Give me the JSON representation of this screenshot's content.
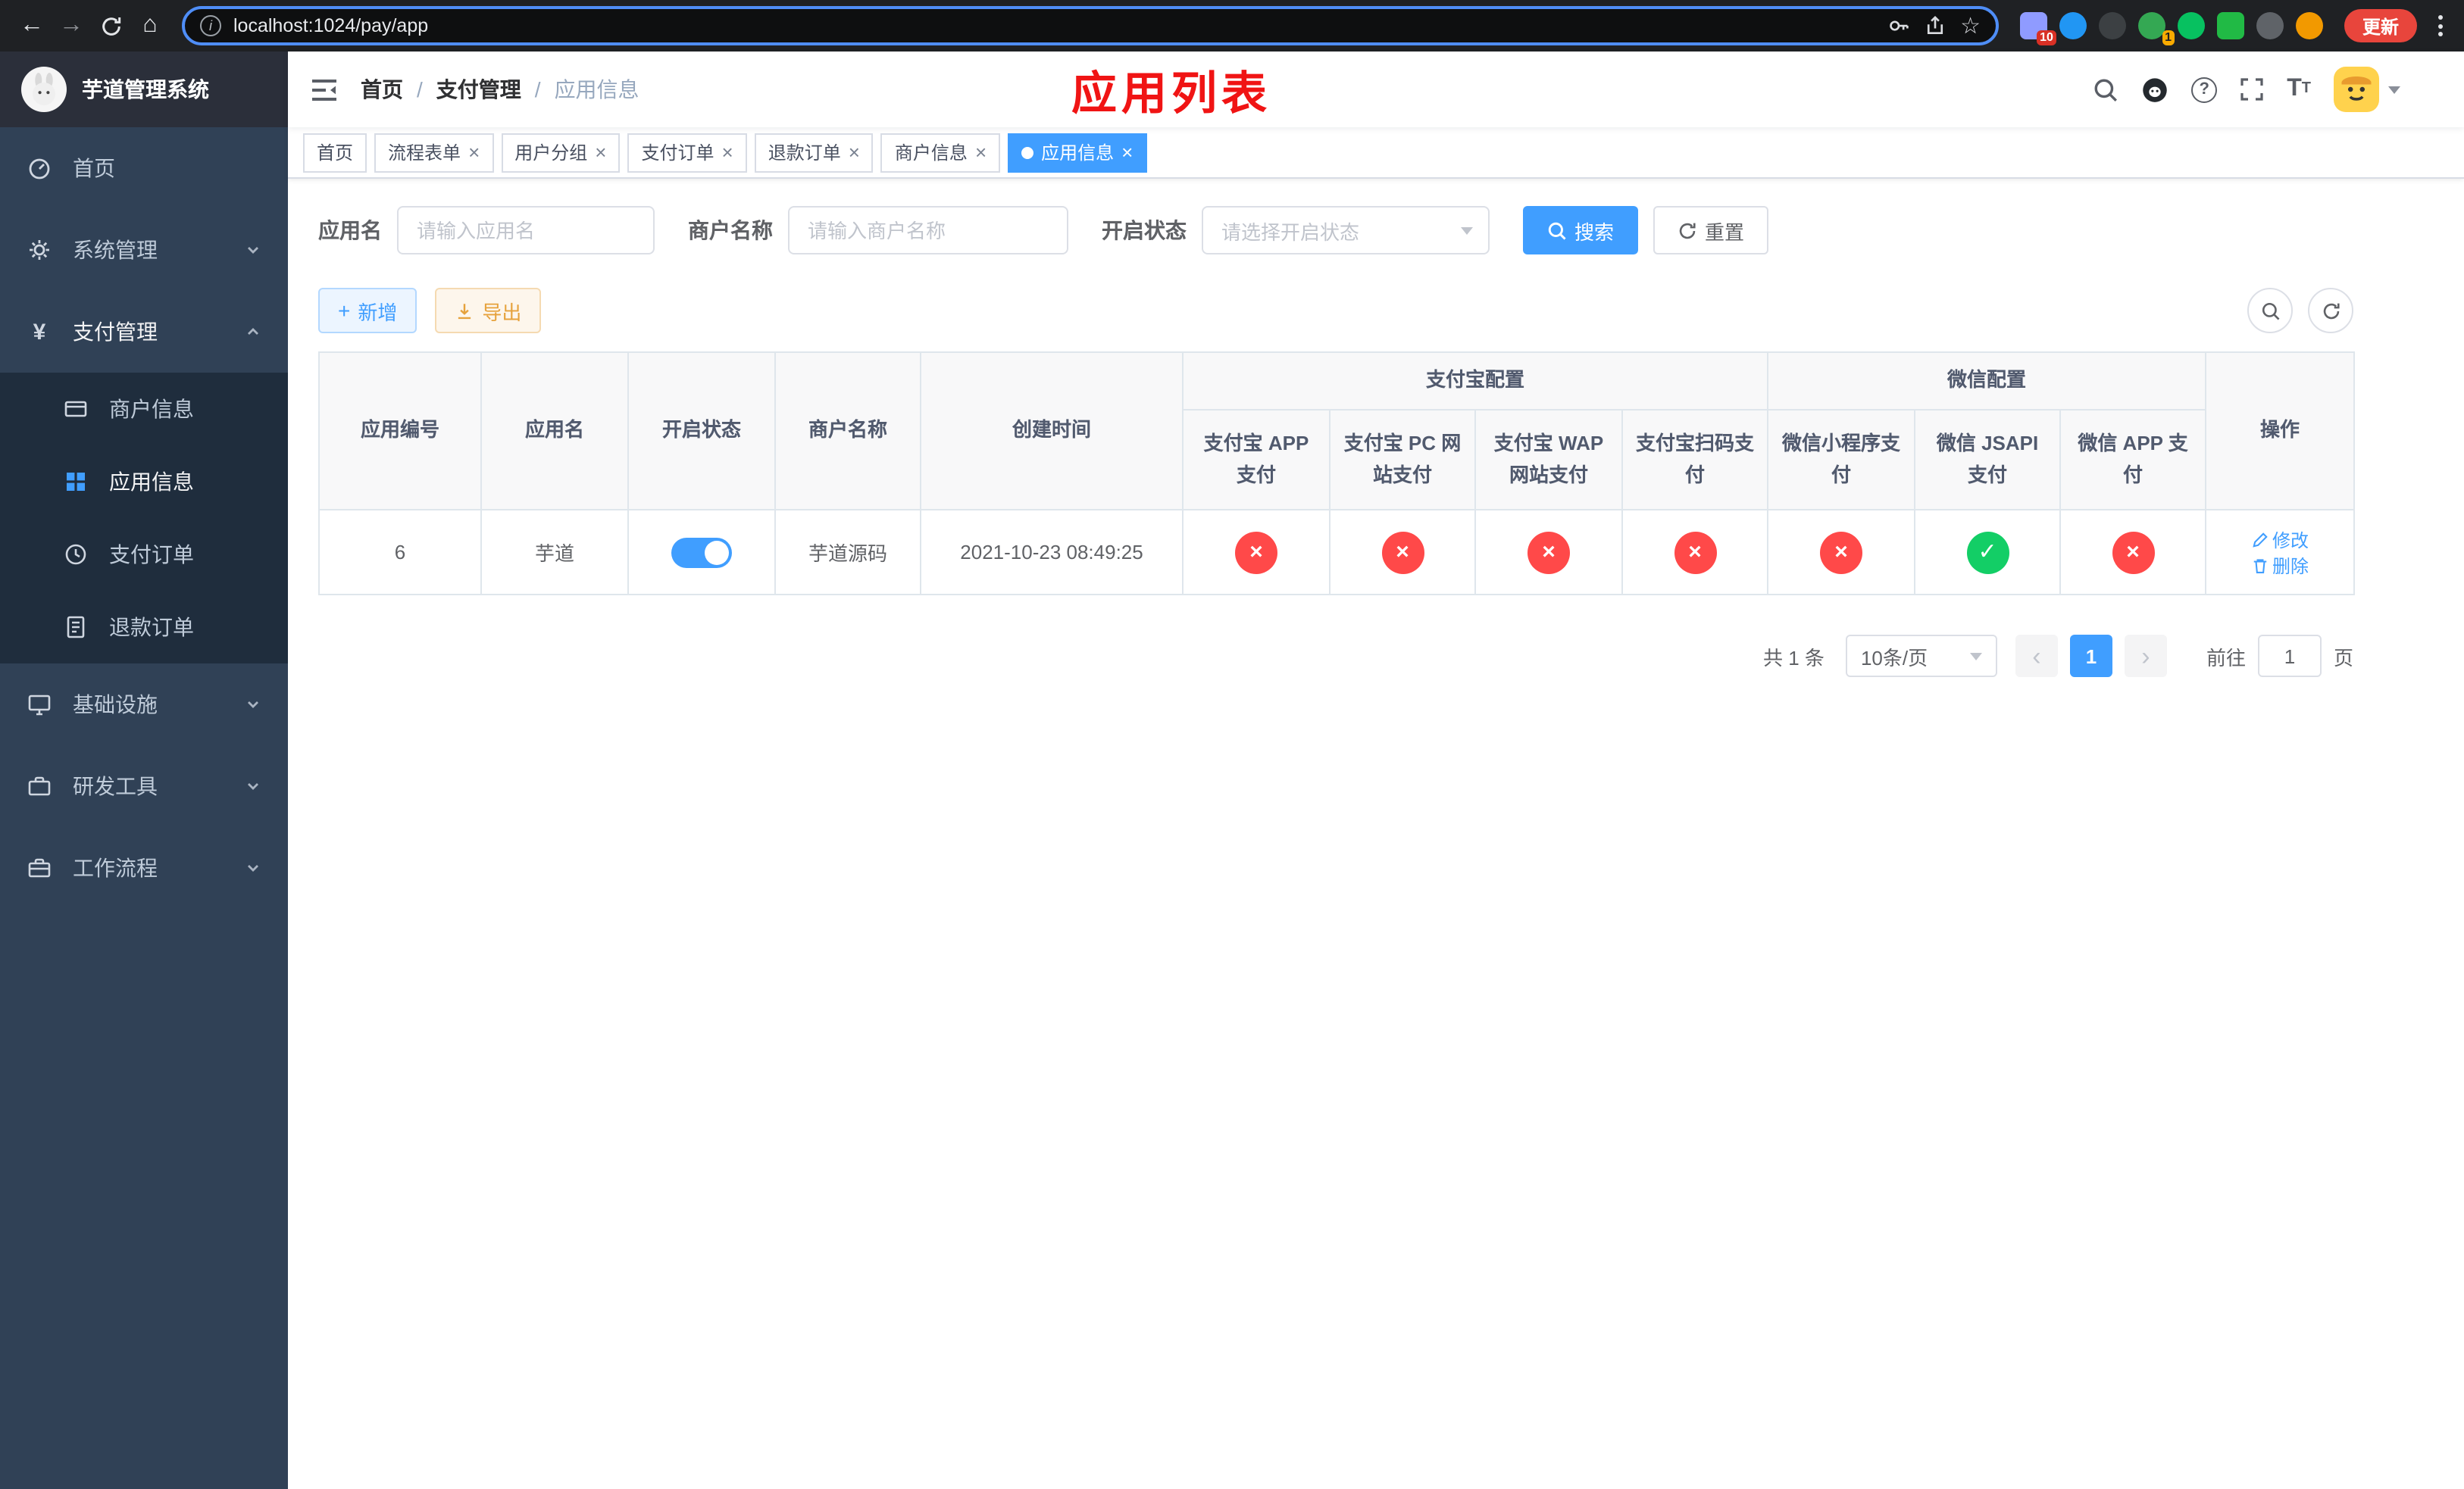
{
  "colors": {
    "primary": "#409EFF",
    "success": "#13ce66",
    "danger": "#ff4949",
    "warning": "#e6a23c",
    "annotation_red": "#f01414",
    "sidebar_bg": "#304156",
    "submenu_bg": "#1f2d3d"
  },
  "browser": {
    "url": "localhost:1024/pay/app",
    "update_label": "更新",
    "ext_badge_1": "10",
    "ext_badge_2": "1"
  },
  "sidebar": {
    "title": "芋道管理系统",
    "items": [
      {
        "label": "首页"
      },
      {
        "label": "系统管理"
      },
      {
        "label": "支付管理"
      },
      {
        "label": "基础设施"
      },
      {
        "label": "研发工具"
      },
      {
        "label": "工作流程"
      }
    ],
    "payment_children": [
      {
        "label": "商户信息"
      },
      {
        "label": "应用信息"
      },
      {
        "label": "支付订单"
      },
      {
        "label": "退款订单"
      }
    ]
  },
  "header": {
    "breadcrumb": [
      "首页",
      "支付管理",
      "应用信息"
    ],
    "separator": "/",
    "annotation": "应用列表"
  },
  "tabs": [
    {
      "label": "首页"
    },
    {
      "label": "流程表单"
    },
    {
      "label": "用户分组"
    },
    {
      "label": "支付订单"
    },
    {
      "label": "退款订单"
    },
    {
      "label": "商户信息"
    },
    {
      "label": "应用信息"
    }
  ],
  "icons": {
    "close": "×",
    "prev": "‹",
    "next": "›"
  },
  "filters": {
    "app_name_label": "应用名",
    "app_name_placeholder": "请输入应用名",
    "merchant_label": "商户名称",
    "merchant_placeholder": "请输入商户名称",
    "status_label": "开启状态",
    "status_placeholder": "请选择开启状态",
    "search_label": "搜索",
    "reset_label": "重置"
  },
  "toolbar": {
    "add_label": "新增",
    "export_label": "导出"
  },
  "table": {
    "headers": {
      "app_id": "应用编号",
      "app_name": "应用名",
      "status": "开启状态",
      "merchant": "商户名称",
      "created": "创建时间",
      "alipay_group": "支付宝配置",
      "wechat_group": "微信配置",
      "alipay_app": "支付宝 APP 支付",
      "alipay_pc": "支付宝 PC 网站支付",
      "alipay_wap": "支付宝 WAP 网站支付",
      "alipay_qr": "支付宝扫码支付",
      "wx_lite": "微信小程序支付",
      "wx_jsapi": "微信 JSAPI 支付",
      "wx_app": "微信 APP 支付",
      "actions": "操作"
    },
    "row": {
      "app_id": "6",
      "app_name": "芋道",
      "status_on": true,
      "merchant": "芋道源码",
      "created": "2021-10-23 08:49:25",
      "channels": {
        "alipay_app": false,
        "alipay_pc": false,
        "alipay_wap": false,
        "alipay_qr": false,
        "wx_lite": false,
        "wx_jsapi": true,
        "wx_app": false
      },
      "edit_label": "修改",
      "delete_label": "删除"
    }
  },
  "pagination": {
    "total": "共 1 条",
    "page_size": "10条/页",
    "page": "1",
    "goto_label": "前往",
    "goto_value": "1",
    "unit_label": "页"
  }
}
